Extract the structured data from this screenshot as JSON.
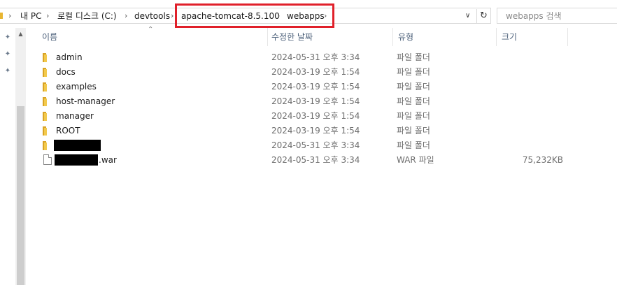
{
  "address_bar": {
    "crumbs": [
      "내 PC",
      "로컬 디스크 (C:)",
      "devtools",
      "apache-tomcat-8.5.100",
      "webapps"
    ],
    "separator": "›",
    "dropdown_glyph": "∨",
    "refresh_glyph": "↻"
  },
  "search": {
    "placeholder": "webapps 검색"
  },
  "columns": {
    "name": "이름",
    "date": "수정한 날짜",
    "type": "유형",
    "size": "크기"
  },
  "files": [
    {
      "name": "admin",
      "date": "2024-05-31 오후 3:34",
      "type": "파일 폴더",
      "size": ""
    },
    {
      "name": "docs",
      "date": "2024-03-19 오후 1:54",
      "type": "파일 폴더",
      "size": ""
    },
    {
      "name": "examples",
      "date": "2024-03-19 오후 1:54",
      "type": "파일 폴더",
      "size": ""
    },
    {
      "name": "host-manager",
      "date": "2024-03-19 오후 1:54",
      "type": "파일 폴더",
      "size": ""
    },
    {
      "name": "manager",
      "date": "2024-03-19 오후 1:54",
      "type": "파일 폴더",
      "size": ""
    },
    {
      "name": "ROOT",
      "date": "2024-03-19 오후 1:54",
      "type": "파일 폴더",
      "size": ""
    },
    {
      "name": "",
      "date": "2024-05-31 오후 3:34",
      "type": "파일 폴더",
      "size": ""
    },
    {
      "name": ".war",
      "date": "2024-05-31 오후 3:34",
      "type": "WAR 파일",
      "size": "75,232KB"
    }
  ],
  "colors": {
    "highlight": "#e0202a",
    "folder": "#f2c94c",
    "header_text": "#4c607a"
  }
}
